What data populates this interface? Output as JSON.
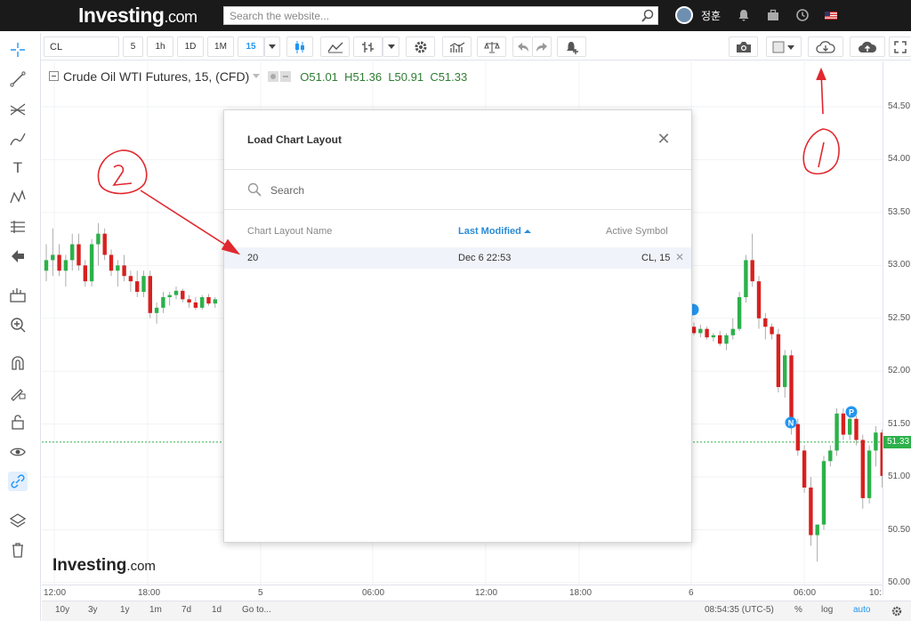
{
  "topbar": {
    "brand": "Investing",
    "brand_suffix": ".com",
    "search_placeholder": "Search the website...",
    "user_name": "정훈"
  },
  "toolbar": {
    "symbol": "CL",
    "intervals": [
      "5",
      "1h",
      "1D",
      "1M",
      "15"
    ],
    "active_interval": "15"
  },
  "legend": {
    "title": "Crude Oil WTI Futures, 15, (CFD)",
    "open": "O51.01",
    "high": "H51.36",
    "low": "L50.91",
    "close": "C51.33"
  },
  "price_axis": {
    "ticks": [
      "54.50",
      "54.00",
      "53.50",
      "53.00",
      "52.50",
      "52.00",
      "51.50",
      "51.00",
      "50.50",
      "50.00"
    ],
    "last_price": "51.33"
  },
  "time_axis": {
    "ticks": [
      "12:00",
      "18:00",
      "5",
      "06:00",
      "12:00",
      "18:00",
      "6",
      "06:00",
      "10:"
    ]
  },
  "bottom_bar": {
    "ranges": [
      "10y",
      "3y",
      "1y",
      "1m",
      "7d",
      "1d",
      "Go to..."
    ],
    "clock": "08:54:35 (UTC-5)",
    "pct": "%",
    "log": "log",
    "auto": "auto"
  },
  "watermark": {
    "brand": "Investing",
    "suffix": ".com"
  },
  "modal": {
    "title": "Load Chart Layout",
    "search_placeholder": "Search",
    "columns": {
      "name": "Chart Layout Name",
      "modified": "Last Modified",
      "symbol": "Active Symbol"
    },
    "rows": [
      {
        "name": "20",
        "modified": "Dec 6 22:53",
        "symbol": "CL, 15"
      }
    ]
  },
  "chart_badges": [
    "N",
    "P"
  ],
  "chart_data": {
    "type": "candlestick",
    "symbol": "Crude Oil WTI Futures, 15, (CFD)",
    "ylim": [
      50.0,
      54.6
    ],
    "candles_left": [
      [
        52.95,
        53.2,
        52.85,
        53.05
      ],
      [
        53.05,
        53.35,
        52.9,
        53.1
      ],
      [
        53.1,
        53.2,
        52.9,
        52.95
      ],
      [
        52.95,
        53.1,
        52.8,
        53.05
      ],
      [
        53.05,
        53.3,
        52.95,
        53.2
      ],
      [
        53.2,
        53.3,
        52.95,
        53.0
      ],
      [
        53.0,
        53.05,
        52.8,
        52.85
      ],
      [
        52.85,
        53.25,
        52.8,
        53.2
      ],
      [
        53.2,
        53.4,
        53.0,
        53.3
      ],
      [
        53.3,
        53.35,
        53.05,
        53.1
      ],
      [
        53.1,
        53.15,
        52.9,
        52.95
      ],
      [
        52.95,
        53.05,
        52.8,
        53.0
      ],
      [
        53.0,
        53.1,
        52.85,
        52.9
      ],
      [
        52.9,
        52.95,
        52.75,
        52.85
      ],
      [
        52.85,
        52.95,
        52.7,
        52.75
      ],
      [
        52.75,
        52.95,
        52.7,
        52.9
      ],
      [
        52.9,
        52.95,
        52.5,
        52.55
      ],
      [
        52.55,
        52.65,
        52.45,
        52.6
      ],
      [
        52.6,
        52.75,
        52.55,
        52.7
      ],
      [
        52.7,
        52.75,
        52.62,
        52.72
      ],
      [
        52.72,
        52.8,
        52.68,
        52.76
      ],
      [
        52.76,
        52.78,
        52.65,
        52.68
      ],
      [
        52.68,
        52.72,
        52.6,
        52.65
      ],
      [
        52.65,
        52.7,
        52.58,
        52.6
      ],
      [
        52.6,
        52.72,
        52.58,
        52.7
      ],
      [
        52.7,
        52.73,
        52.62,
        52.64
      ],
      [
        52.64,
        52.7,
        52.6,
        52.68
      ]
    ],
    "candles_right": [
      [
        52.42,
        52.46,
        52.34,
        52.36
      ],
      [
        52.36,
        52.44,
        52.32,
        52.4
      ],
      [
        52.4,
        52.42,
        52.3,
        52.32
      ],
      [
        52.32,
        52.36,
        52.28,
        52.34
      ],
      [
        52.34,
        52.38,
        52.24,
        52.26
      ],
      [
        52.26,
        52.36,
        52.2,
        52.34
      ],
      [
        52.34,
        52.5,
        52.3,
        52.4
      ],
      [
        52.4,
        52.75,
        52.38,
        52.7
      ],
      [
        52.7,
        53.1,
        52.65,
        53.05
      ],
      [
        53.05,
        53.3,
        52.8,
        52.85
      ],
      [
        52.85,
        52.9,
        52.4,
        52.5
      ],
      [
        52.5,
        52.55,
        52.3,
        52.42
      ],
      [
        52.42,
        52.45,
        52.3,
        52.35
      ],
      [
        52.35,
        52.4,
        51.8,
        51.85
      ],
      [
        51.85,
        52.2,
        51.75,
        52.15
      ],
      [
        52.15,
        52.2,
        51.4,
        51.5
      ],
      [
        51.5,
        51.55,
        51.2,
        51.25
      ],
      [
        51.25,
        51.3,
        50.85,
        50.9
      ],
      [
        50.9,
        51.0,
        50.35,
        50.45
      ],
      [
        50.45,
        50.5,
        50.2,
        50.55
      ],
      [
        50.55,
        51.2,
        50.5,
        51.15
      ],
      [
        51.15,
        51.3,
        51.1,
        51.25
      ],
      [
        51.25,
        51.65,
        51.2,
        51.6
      ],
      [
        51.6,
        51.65,
        51.35,
        51.4
      ],
      [
        51.4,
        51.62,
        51.35,
        51.55
      ],
      [
        51.55,
        51.58,
        51.3,
        51.35
      ],
      [
        51.35,
        51.4,
        50.7,
        50.8
      ],
      [
        50.8,
        51.3,
        50.75,
        51.25
      ],
      [
        51.25,
        51.48,
        51.1,
        51.42
      ],
      [
        51.42,
        51.45,
        50.9,
        51.01
      ],
      [
        51.01,
        51.36,
        50.91,
        51.33
      ]
    ],
    "last_price": 51.33,
    "colors": {
      "up": "#2cb14a",
      "down": "#d8201f"
    }
  },
  "colors": {
    "accent": "#2196f3",
    "up": "#2cb14a",
    "down": "#d8201f",
    "annotation": "#e0282e"
  }
}
